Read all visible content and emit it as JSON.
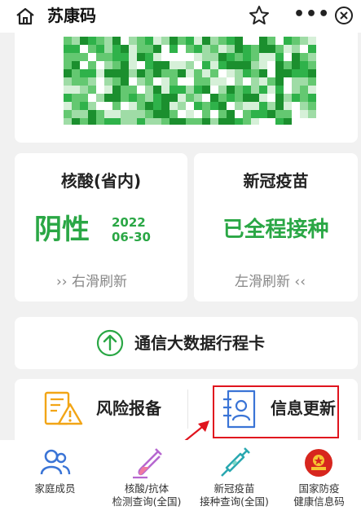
{
  "topbar": {
    "title": "苏康码"
  },
  "nucleic": {
    "title": "核酸(省内)",
    "result": "阴性",
    "year": "2022",
    "date": "06-30",
    "swipe": "›› 右滑刷新"
  },
  "vaccine": {
    "title": "新冠疫苗",
    "status": "已全程接种",
    "swipe": "左滑刷新 ‹‹"
  },
  "trip": {
    "label": "通信大数据行程卡"
  },
  "services": {
    "risk": "风险报备",
    "info": "信息更新"
  },
  "tabs": [
    {
      "line1": "家庭成员",
      "line2": ""
    },
    {
      "line1": "核酸/抗体",
      "line2": "检测查询(全国)"
    },
    {
      "line1": "新冠疫苗",
      "line2": "接种查询(全国)"
    },
    {
      "line1": "国家防疫",
      "line2": "健康信息码"
    }
  ],
  "colors": {
    "green": "#2aa745",
    "highlight": "#e0141e",
    "orange": "#f2a516",
    "blue": "#3a74d6"
  }
}
